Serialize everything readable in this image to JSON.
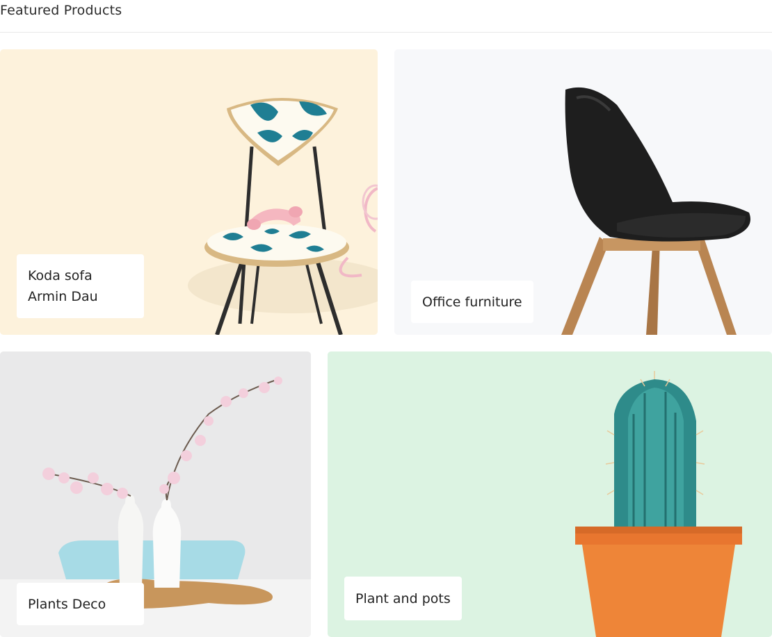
{
  "section": {
    "title": "Featured Products"
  },
  "cards": [
    {
      "line1": "Koda sofa",
      "line2": "Armin Dau",
      "bg_color": "#fdf2dc",
      "image": "patterned-chair-with-pink-telephone"
    },
    {
      "line1": "Office furniture",
      "bg_color": "#f7f8fa",
      "image": "black-shell-chair"
    },
    {
      "line1": "Plants Deco",
      "bg_color": "#e9e9ea",
      "image": "white-vases-with-blossom-branches"
    },
    {
      "line1": "Plant and pots",
      "bg_color": "#dcf3e2",
      "image": "cactus-in-terracotta-pot"
    }
  ]
}
